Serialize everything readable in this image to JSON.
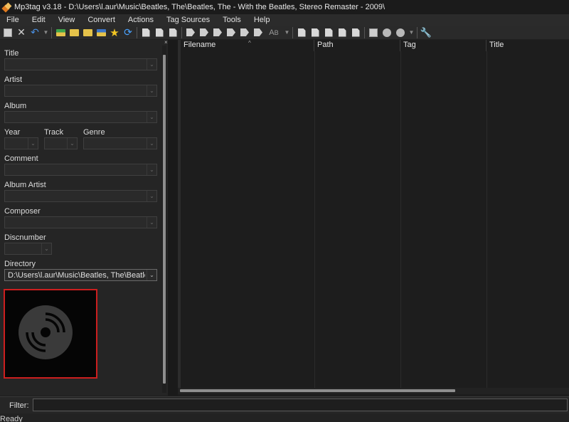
{
  "window": {
    "title": "Mp3tag v3.18  -  D:\\Users\\l.aur\\Music\\Beatles, The\\Beatles, The - With the Beatles, Stereo Remaster - 2009\\"
  },
  "menu": [
    "File",
    "Edit",
    "View",
    "Convert",
    "Actions",
    "Tag Sources",
    "Tools",
    "Help"
  ],
  "toolbar": {
    "icons": [
      "save-icon",
      "remove-tag-icon",
      "undo-icon",
      "open-folder-icon",
      "add-folder-icon",
      "favorite-star-icon",
      "refresh-icon",
      "tag-to-filename-icon",
      "tag-sources-icon",
      "web-icon",
      "options-wrench-icon"
    ]
  },
  "tag_panel": {
    "title_label": "Title",
    "artist_label": "Artist",
    "album_label": "Album",
    "year_label": "Year",
    "track_label": "Track",
    "genre_label": "Genre",
    "comment_label": "Comment",
    "album_artist_label": "Album Artist",
    "composer_label": "Composer",
    "discnumber_label": "Discnumber",
    "directory_label": "Directory",
    "directory_value": "D:\\Users\\l.aur\\Music\\Beatles, The\\Beatles, The"
  },
  "file_list": {
    "columns": [
      "Filename",
      "Path",
      "Tag",
      "Title"
    ],
    "sorted_column": "Filename"
  },
  "filter": {
    "label": "Filter:",
    "value": ""
  },
  "status": {
    "text": "Ready"
  }
}
